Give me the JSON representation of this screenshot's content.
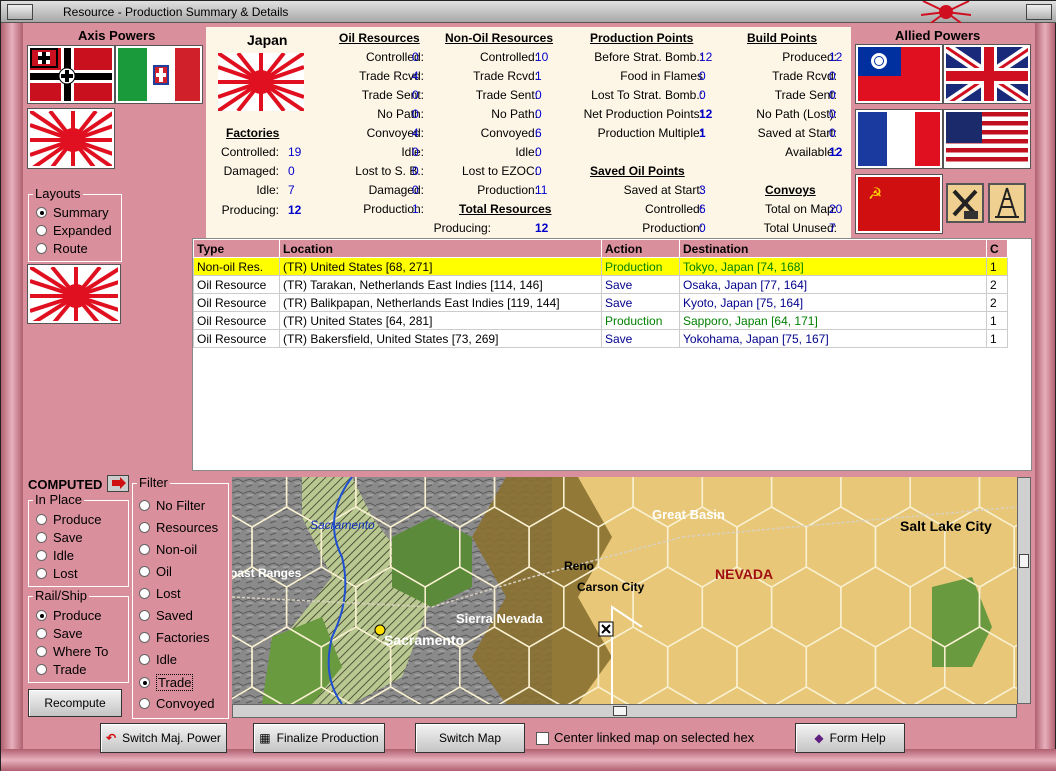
{
  "window": {
    "title": "Resource - Production Summary & Details"
  },
  "axis": {
    "title": "Axis Powers"
  },
  "allied": {
    "title": "Allied Powers"
  },
  "layouts": {
    "label": "Layouts",
    "options": [
      "Summary",
      "Expanded",
      "Route"
    ],
    "selected": 0
  },
  "country": "Japan",
  "factories": {
    "title": "Factories",
    "rows": [
      [
        "Controlled:",
        "19"
      ],
      [
        "Damaged:",
        "0"
      ],
      [
        "Idle:",
        "7"
      ],
      [
        "Producing:",
        "12"
      ]
    ]
  },
  "oil": {
    "title": "Oil Resources",
    "rows": [
      [
        "Controlled:",
        "0"
      ],
      [
        "Trade Rcvd:",
        "4"
      ],
      [
        "Trade Sent:",
        "0"
      ],
      [
        "No Path:",
        "0"
      ],
      [
        "Convoyed:",
        "4"
      ],
      [
        "Idle:",
        "0"
      ],
      [
        "Lost to S. B.:",
        "0"
      ],
      [
        "Damaged:",
        "0"
      ],
      [
        "Production:",
        "1"
      ]
    ]
  },
  "nonoil": {
    "title": "Non-Oil Resources",
    "rows": [
      [
        "Controlled:",
        "10"
      ],
      [
        "Trade Rcvd:",
        "1"
      ],
      [
        "Trade Sent:",
        "0"
      ],
      [
        "No Path:",
        "0"
      ],
      [
        "Convoyed:",
        "6"
      ],
      [
        "Idle:",
        "0"
      ],
      [
        "Lost to EZOC:",
        "0"
      ],
      [
        "Production:",
        "11"
      ]
    ]
  },
  "total": {
    "title": "Total Resources",
    "rows": [
      [
        "Producing:",
        "12"
      ]
    ]
  },
  "pp": {
    "title": "Production Points",
    "rows": [
      [
        "Before Strat. Bomb.:",
        "12"
      ],
      [
        "Food in Flames",
        "0"
      ],
      [
        "Lost To Strat. Bomb.:",
        "0"
      ],
      [
        "Net Production Points:",
        "12"
      ],
      [
        "Production Multiple:",
        "1"
      ]
    ]
  },
  "savedoil": {
    "title": "Saved Oil Points",
    "rows": [
      [
        "Saved at Start:",
        "3"
      ],
      [
        "Controlled:",
        "6"
      ],
      [
        "Production:",
        "0"
      ]
    ]
  },
  "bp": {
    "title": "Build Points",
    "rows": [
      [
        "Produced:",
        "12"
      ],
      [
        "Trade Rcvd:",
        "0"
      ],
      [
        "Trade Sent:",
        "0"
      ],
      [
        "No Path (Lost):",
        "0"
      ],
      [
        "Saved at Start:",
        "0"
      ],
      [
        "Available:",
        "12"
      ]
    ]
  },
  "convoys": {
    "title": "Convoys",
    "rows": [
      [
        "Total on Map:",
        "20"
      ],
      [
        "Total Unused:",
        "7"
      ]
    ]
  },
  "table": {
    "headers": [
      "Type",
      "Location",
      "Action",
      "Destination",
      "C"
    ],
    "rows": [
      [
        "Non-oil Res.",
        "(TR) United States [68, 271]",
        "Production",
        "Tokyo, Japan [74, 168]",
        "1"
      ],
      [
        "Oil Resource",
        "(TR) Tarakan, Netherlands East Indies [114, 146]",
        "Save",
        "Osaka, Japan [77, 164]",
        "2"
      ],
      [
        "Oil Resource",
        "(TR) Balikpapan, Netherlands East Indies [119, 144]",
        "Save",
        "Kyoto, Japan [75, 164]",
        "2"
      ],
      [
        "Oil Resource",
        "(TR) United States [64, 281]",
        "Production",
        "Sapporo, Japan [64, 171]",
        "1"
      ],
      [
        "Oil Resource",
        "(TR) Bakersfield, United States [73, 269]",
        "Save",
        "Yokohama, Japan [75, 167]",
        "1"
      ]
    ]
  },
  "computed": {
    "label": "COMPUTED"
  },
  "inplace": {
    "label": "In Place",
    "options": [
      "Produce",
      "Save",
      "Idle",
      "Lost"
    ]
  },
  "railship": {
    "label": "Rail/Ship",
    "options": [
      "Produce",
      "Save",
      "Where To",
      "Trade"
    ],
    "selected": 0
  },
  "filter": {
    "label": "Filter",
    "options": [
      "No Filter",
      "Resources",
      "Non-oil",
      "Oil",
      "Lost",
      "Saved",
      "Factories",
      "Idle",
      "Trade",
      "Convoyed"
    ],
    "selected": 8
  },
  "map": {
    "labels": [
      "Sacramento",
      "Great Basin",
      "Salt Lake City",
      "Reno",
      "Carson City",
      "NEVADA",
      "oast Ranges",
      "Sierra Nevada",
      "Sacramento"
    ]
  },
  "buttons": {
    "recompute": "Recompute",
    "switch_major": "Switch Maj. Power",
    "finalize": "Finalize Production",
    "switch_map": "Switch Map",
    "center_label": "Center linked map on selected hex",
    "form_help": "Form Help"
  },
  "colors": {
    "bg": "#d9909c",
    "selected_row": "#ffff00",
    "link": "#0000cc"
  }
}
